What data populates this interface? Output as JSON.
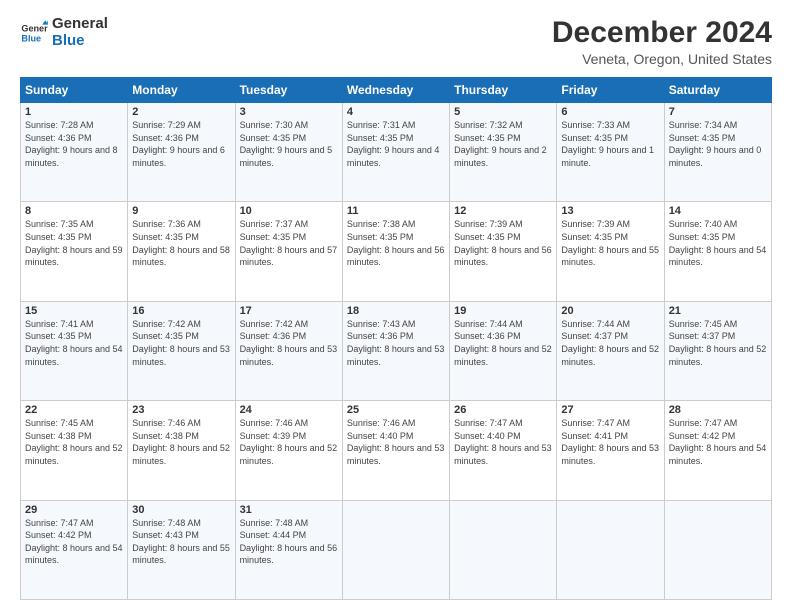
{
  "logo": {
    "line1": "General",
    "line2": "Blue"
  },
  "title": "December 2024",
  "subtitle": "Veneta, Oregon, United States",
  "days_of_week": [
    "Sunday",
    "Monday",
    "Tuesday",
    "Wednesday",
    "Thursday",
    "Friday",
    "Saturday"
  ],
  "weeks": [
    [
      {
        "day": "1",
        "rise": "Sunrise: 7:28 AM",
        "set": "Sunset: 4:36 PM",
        "daylight": "Daylight: 9 hours and 8 minutes."
      },
      {
        "day": "2",
        "rise": "Sunrise: 7:29 AM",
        "set": "Sunset: 4:36 PM",
        "daylight": "Daylight: 9 hours and 6 minutes."
      },
      {
        "day": "3",
        "rise": "Sunrise: 7:30 AM",
        "set": "Sunset: 4:35 PM",
        "daylight": "Daylight: 9 hours and 5 minutes."
      },
      {
        "day": "4",
        "rise": "Sunrise: 7:31 AM",
        "set": "Sunset: 4:35 PM",
        "daylight": "Daylight: 9 hours and 4 minutes."
      },
      {
        "day": "5",
        "rise": "Sunrise: 7:32 AM",
        "set": "Sunset: 4:35 PM",
        "daylight": "Daylight: 9 hours and 2 minutes."
      },
      {
        "day": "6",
        "rise": "Sunrise: 7:33 AM",
        "set": "Sunset: 4:35 PM",
        "daylight": "Daylight: 9 hours and 1 minute."
      },
      {
        "day": "7",
        "rise": "Sunrise: 7:34 AM",
        "set": "Sunset: 4:35 PM",
        "daylight": "Daylight: 9 hours and 0 minutes."
      }
    ],
    [
      {
        "day": "8",
        "rise": "Sunrise: 7:35 AM",
        "set": "Sunset: 4:35 PM",
        "daylight": "Daylight: 8 hours and 59 minutes."
      },
      {
        "day": "9",
        "rise": "Sunrise: 7:36 AM",
        "set": "Sunset: 4:35 PM",
        "daylight": "Daylight: 8 hours and 58 minutes."
      },
      {
        "day": "10",
        "rise": "Sunrise: 7:37 AM",
        "set": "Sunset: 4:35 PM",
        "daylight": "Daylight: 8 hours and 57 minutes."
      },
      {
        "day": "11",
        "rise": "Sunrise: 7:38 AM",
        "set": "Sunset: 4:35 PM",
        "daylight": "Daylight: 8 hours and 56 minutes."
      },
      {
        "day": "12",
        "rise": "Sunrise: 7:39 AM",
        "set": "Sunset: 4:35 PM",
        "daylight": "Daylight: 8 hours and 56 minutes."
      },
      {
        "day": "13",
        "rise": "Sunrise: 7:39 AM",
        "set": "Sunset: 4:35 PM",
        "daylight": "Daylight: 8 hours and 55 minutes."
      },
      {
        "day": "14",
        "rise": "Sunrise: 7:40 AM",
        "set": "Sunset: 4:35 PM",
        "daylight": "Daylight: 8 hours and 54 minutes."
      }
    ],
    [
      {
        "day": "15",
        "rise": "Sunrise: 7:41 AM",
        "set": "Sunset: 4:35 PM",
        "daylight": "Daylight: 8 hours and 54 minutes."
      },
      {
        "day": "16",
        "rise": "Sunrise: 7:42 AM",
        "set": "Sunset: 4:35 PM",
        "daylight": "Daylight: 8 hours and 53 minutes."
      },
      {
        "day": "17",
        "rise": "Sunrise: 7:42 AM",
        "set": "Sunset: 4:36 PM",
        "daylight": "Daylight: 8 hours and 53 minutes."
      },
      {
        "day": "18",
        "rise": "Sunrise: 7:43 AM",
        "set": "Sunset: 4:36 PM",
        "daylight": "Daylight: 8 hours and 53 minutes."
      },
      {
        "day": "19",
        "rise": "Sunrise: 7:44 AM",
        "set": "Sunset: 4:36 PM",
        "daylight": "Daylight: 8 hours and 52 minutes."
      },
      {
        "day": "20",
        "rise": "Sunrise: 7:44 AM",
        "set": "Sunset: 4:37 PM",
        "daylight": "Daylight: 8 hours and 52 minutes."
      },
      {
        "day": "21",
        "rise": "Sunrise: 7:45 AM",
        "set": "Sunset: 4:37 PM",
        "daylight": "Daylight: 8 hours and 52 minutes."
      }
    ],
    [
      {
        "day": "22",
        "rise": "Sunrise: 7:45 AM",
        "set": "Sunset: 4:38 PM",
        "daylight": "Daylight: 8 hours and 52 minutes."
      },
      {
        "day": "23",
        "rise": "Sunrise: 7:46 AM",
        "set": "Sunset: 4:38 PM",
        "daylight": "Daylight: 8 hours and 52 minutes."
      },
      {
        "day": "24",
        "rise": "Sunrise: 7:46 AM",
        "set": "Sunset: 4:39 PM",
        "daylight": "Daylight: 8 hours and 52 minutes."
      },
      {
        "day": "25",
        "rise": "Sunrise: 7:46 AM",
        "set": "Sunset: 4:40 PM",
        "daylight": "Daylight: 8 hours and 53 minutes."
      },
      {
        "day": "26",
        "rise": "Sunrise: 7:47 AM",
        "set": "Sunset: 4:40 PM",
        "daylight": "Daylight: 8 hours and 53 minutes."
      },
      {
        "day": "27",
        "rise": "Sunrise: 7:47 AM",
        "set": "Sunset: 4:41 PM",
        "daylight": "Daylight: 8 hours and 53 minutes."
      },
      {
        "day": "28",
        "rise": "Sunrise: 7:47 AM",
        "set": "Sunset: 4:42 PM",
        "daylight": "Daylight: 8 hours and 54 minutes."
      }
    ],
    [
      {
        "day": "29",
        "rise": "Sunrise: 7:47 AM",
        "set": "Sunset: 4:42 PM",
        "daylight": "Daylight: 8 hours and 54 minutes."
      },
      {
        "day": "30",
        "rise": "Sunrise: 7:48 AM",
        "set": "Sunset: 4:43 PM",
        "daylight": "Daylight: 8 hours and 55 minutes."
      },
      {
        "day": "31",
        "rise": "Sunrise: 7:48 AM",
        "set": "Sunset: 4:44 PM",
        "daylight": "Daylight: 8 hours and 56 minutes."
      },
      null,
      null,
      null,
      null
    ]
  ]
}
